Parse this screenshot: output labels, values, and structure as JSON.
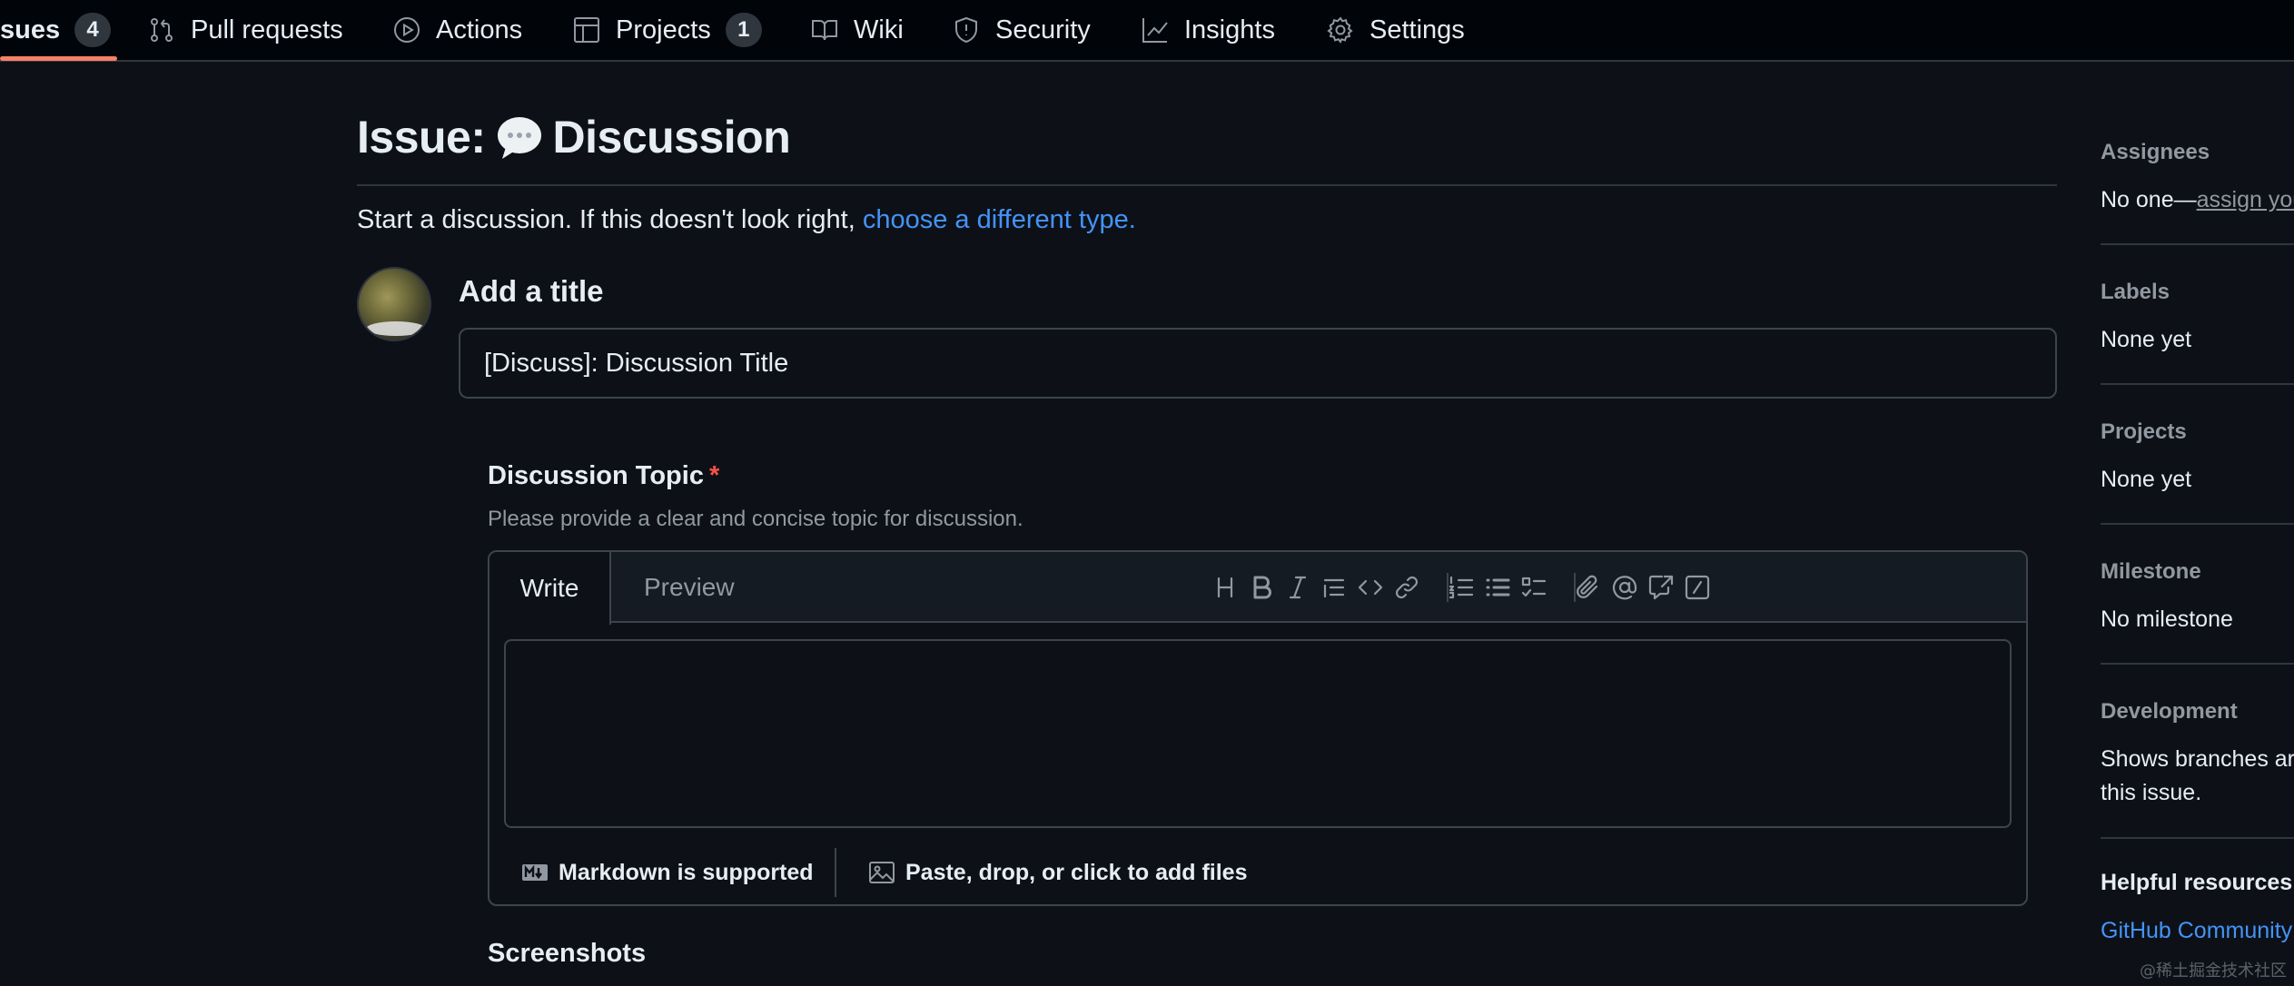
{
  "nav": {
    "issues": {
      "label": "sues",
      "count": "4"
    },
    "pull_requests": {
      "label": "Pull requests"
    },
    "actions": {
      "label": "Actions"
    },
    "projects": {
      "label": "Projects",
      "count": "1"
    },
    "wiki": {
      "label": "Wiki"
    },
    "security": {
      "label": "Security"
    },
    "insights": {
      "label": "Insights"
    },
    "settings": {
      "label": "Settings"
    }
  },
  "header": {
    "title_prefix": "Issue:",
    "title": "Discussion",
    "subtitle": "Start a discussion. If this doesn't look right,",
    "subtitle_link": "choose a different type."
  },
  "form": {
    "add_title_label": "Add a title",
    "title_value": "[Discuss]: Discussion Title",
    "topic_label": "Discussion Topic",
    "required_mark": "*",
    "topic_description": "Please provide a clear and concise topic for discussion.",
    "tab_write": "Write",
    "tab_preview": "Preview",
    "textarea_value": "",
    "markdown_note": "Markdown is supported",
    "attach_note": "Paste, drop, or click to add files",
    "screenshots_label": "Screenshots"
  },
  "sidebar": {
    "assignees": {
      "heading": "Assignees",
      "value": "No one—",
      "link": "assign you"
    },
    "labels": {
      "heading": "Labels",
      "value": "None yet"
    },
    "projects": {
      "heading": "Projects",
      "value": "None yet"
    },
    "milestone": {
      "heading": "Milestone",
      "value": "No milestone"
    },
    "development": {
      "heading": "Development",
      "line1": "Shows branches ar",
      "line2": "this issue."
    },
    "helpful": {
      "heading": "Helpful resources",
      "link": "GitHub Community"
    }
  },
  "watermark": "@稀土掘金技术社区",
  "colors": {
    "accent": "#4493f8",
    "underline": "#f78166",
    "required": "#f85149",
    "background": "#0d1117"
  }
}
